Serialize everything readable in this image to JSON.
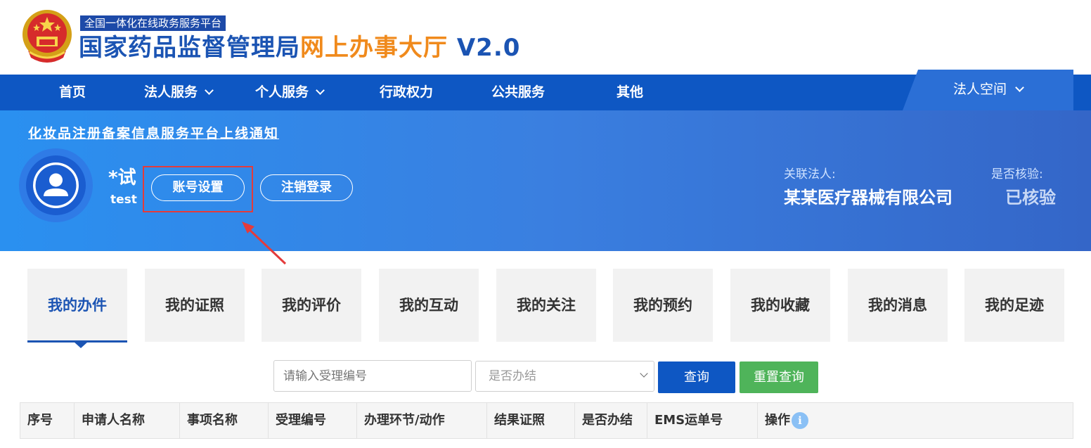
{
  "header": {
    "subtag": "全国一体化在线政务服务平台",
    "title_part1": "国家药品监督管理局",
    "title_part2": "网上办事大厅",
    "title_part3": "V2.0",
    "emblem_icon": "national-emblem-icon"
  },
  "nav": {
    "items": [
      {
        "label": "首页"
      },
      {
        "label": "法人服务",
        "icon": "chevron-down-icon"
      },
      {
        "label": "个人服务",
        "icon": "chevron-down-icon"
      },
      {
        "label": "行政权力"
      },
      {
        "label": "公共服务"
      },
      {
        "label": "其他"
      }
    ],
    "space_label": "法人空间"
  },
  "banner": {
    "notice": "化妆品注册备案信息服务平台上线通知",
    "user_name": "*试",
    "user_login": "test",
    "account_settings": "账号设置",
    "logout": "注销登录",
    "related_label": "关联法人:",
    "related_value": "某某医疗器械有限公司",
    "verified_label": "是否核验:",
    "verified_value": "已核验"
  },
  "tabs": [
    {
      "label": "我的办件",
      "active": true
    },
    {
      "label": "我的证照"
    },
    {
      "label": "我的评价"
    },
    {
      "label": "我的互动"
    },
    {
      "label": "我的关注"
    },
    {
      "label": "我的预约"
    },
    {
      "label": "我的收藏"
    },
    {
      "label": "我的消息"
    },
    {
      "label": "我的足迹"
    }
  ],
  "search": {
    "placeholder": "请输入受理编号",
    "select_value": "是否办结",
    "query_button": "查询",
    "reset_button": "重置查询"
  },
  "table": {
    "columns": [
      "序号",
      "申请人名称",
      "事项名称",
      "受理编号",
      "办理环节/动作",
      "结果证照",
      "是否办结",
      "EMS运单号",
      "操作"
    ]
  },
  "colors": {
    "nav_bg": "#0e57c3",
    "brand_blue": "#1b54b3",
    "brand_orange": "#f08a1c",
    "highlight_red": "#e43b3b",
    "reset_green": "#4fb45a"
  }
}
